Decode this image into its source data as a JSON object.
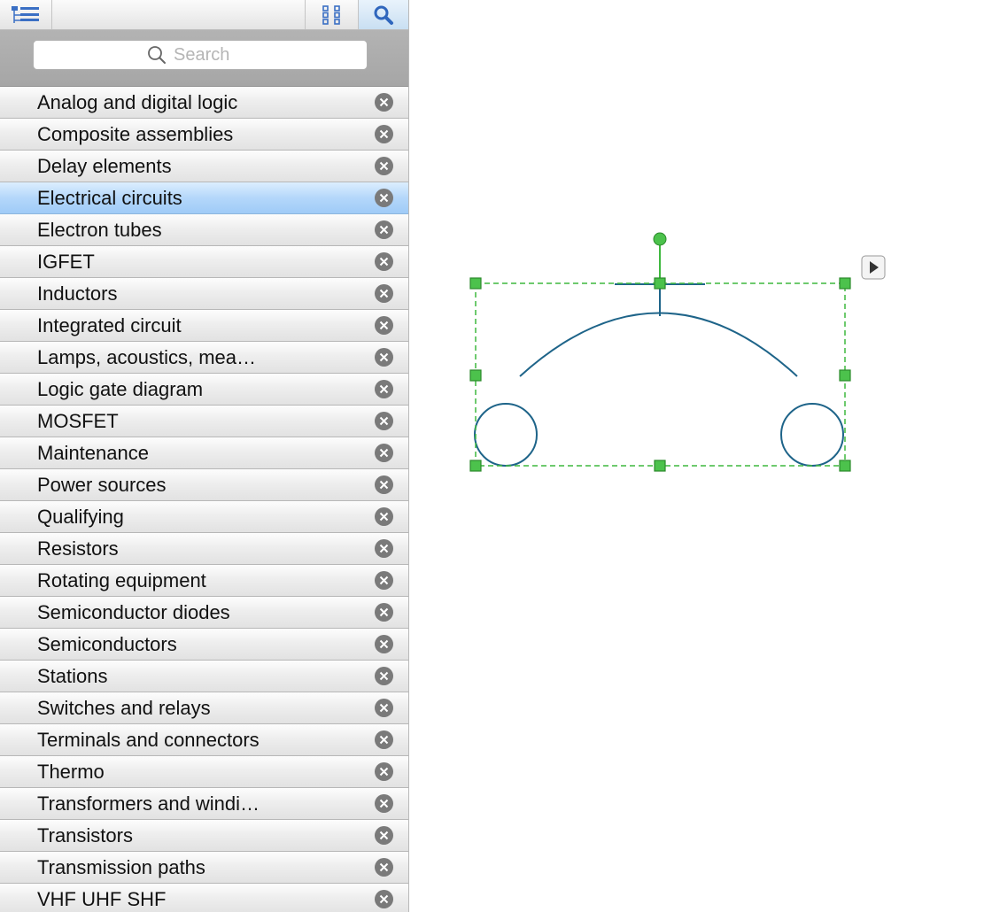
{
  "toolbar": {
    "buttons": [
      {
        "name": "tree-view",
        "icon": "tree-view-icon"
      },
      {
        "name": "grid-view",
        "icon": "grid-icon"
      },
      {
        "name": "search",
        "icon": "search-icon",
        "active": true
      }
    ]
  },
  "search": {
    "placeholder": "Search",
    "value": ""
  },
  "library": {
    "selected_index": 3,
    "items": [
      {
        "label": "Analog and digital logic"
      },
      {
        "label": "Composite assemblies"
      },
      {
        "label": "Delay elements"
      },
      {
        "label": "Electrical circuits"
      },
      {
        "label": "Electron tubes"
      },
      {
        "label": "IGFET"
      },
      {
        "label": "Inductors"
      },
      {
        "label": "Integrated circuit"
      },
      {
        "label": "Lamps, acoustics, mea…"
      },
      {
        "label": "Logic gate diagram"
      },
      {
        "label": "MOSFET"
      },
      {
        "label": "Maintenance"
      },
      {
        "label": "Power sources"
      },
      {
        "label": "Qualifying"
      },
      {
        "label": "Resistors"
      },
      {
        "label": "Rotating equipment"
      },
      {
        "label": "Semiconductor diodes"
      },
      {
        "label": "Semiconductors"
      },
      {
        "label": "Stations"
      },
      {
        "label": "Switches and relays"
      },
      {
        "label": "Terminals and connectors"
      },
      {
        "label": "Thermo"
      },
      {
        "label": "Transformers and windi…"
      },
      {
        "label": "Transistors"
      },
      {
        "label": "Transmission paths"
      },
      {
        "label": "VHF UHF SHF"
      }
    ]
  },
  "canvas": {
    "selected_shape": "circuit-symbol",
    "colors": {
      "shape_stroke": "#1e6489",
      "selection": "#3fb83f",
      "handle_fill": "#4cc24c",
      "handle_stroke": "#2b8a2b"
    }
  }
}
